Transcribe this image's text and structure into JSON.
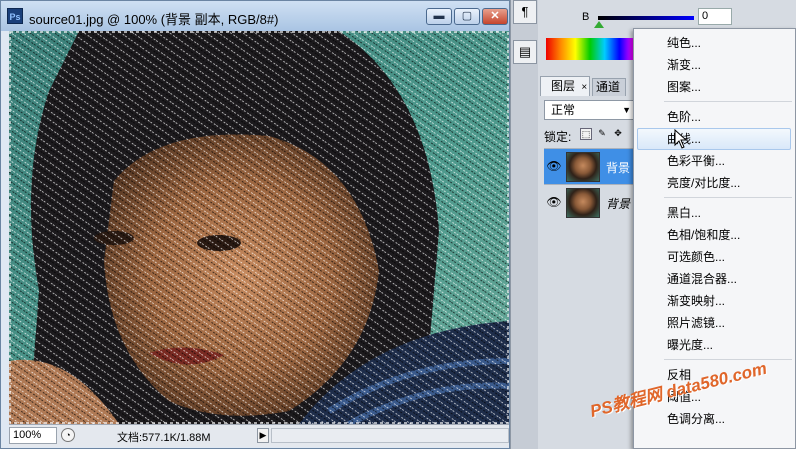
{
  "document": {
    "title": "source01.jpg @ 100% (背景 副本, RGB/8#)",
    "ps_icon": "Ps",
    "minimize": "▬",
    "maximize": "▢",
    "close": "✕",
    "zoom": "100%",
    "info": "文档:577.1K/1.88M",
    "status_arrow": "▶"
  },
  "color_panel": {
    "b_label": "B",
    "b_value": "0"
  },
  "toolstrip": {
    "paragraph_icon": "¶",
    "doc_icon": "▤"
  },
  "layers_panel": {
    "tab_layers": "图层",
    "tab_layers_close": "×",
    "tab_channels": "通道",
    "blend_mode": "正常",
    "lock_label": "锁定:",
    "layers": [
      {
        "name": "背景",
        "selected": true
      },
      {
        "name": "背景",
        "selected": false,
        "italic": true
      }
    ]
  },
  "menu": {
    "items": [
      {
        "label": "纯色..."
      },
      {
        "label": "渐变..."
      },
      {
        "label": "图案..."
      },
      {
        "label": "色阶..."
      },
      {
        "label": "曲线...",
        "highlighted": true
      },
      {
        "label": "色彩平衡..."
      },
      {
        "label": "亮度/对比度..."
      },
      {
        "label": "黑白..."
      },
      {
        "label": "色相/饱和度..."
      },
      {
        "label": "可选颜色..."
      },
      {
        "label": "通道混合器..."
      },
      {
        "label": "渐变映射..."
      },
      {
        "label": "照片滤镜..."
      },
      {
        "label": "曝光度..."
      },
      {
        "label": "反相"
      },
      {
        "label": "阈值..."
      },
      {
        "label": "色调分离..."
      }
    ]
  },
  "watermark": "PS教程网 data580.com",
  "colors": {
    "selection_blue": "#3c8ee8",
    "titlebar": "#bcd1ea",
    "menu_highlight": "#d9e8f9"
  }
}
